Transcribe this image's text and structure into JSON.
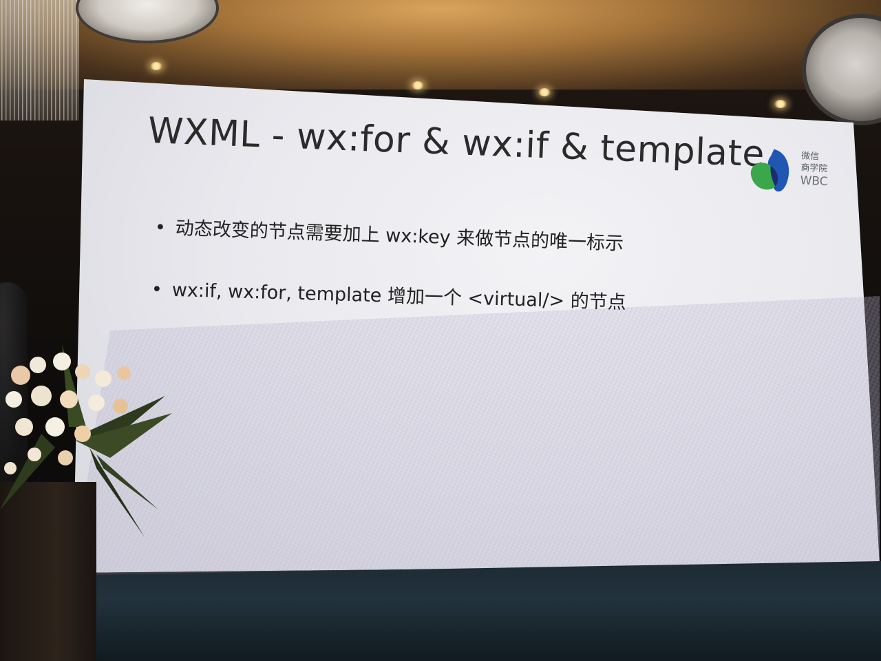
{
  "slide": {
    "title": "WXML - wx:for & wx:if & template",
    "bullets": [
      "动态改变的节点需要加上 wx:key 来做节点的唯一标示",
      "wx:if, wx:for, template 增加一个 <virtual/> 的节点"
    ],
    "bullet_symbol": "•",
    "logo": {
      "line1": "微信",
      "line2": "商学院",
      "line3": "WBC",
      "colors": {
        "blue": "#1f57b3",
        "green": "#3aa84a",
        "navy": "#1c2d6e"
      }
    }
  },
  "colors": {
    "slide_background": "#ececf0",
    "slide_text": "#2b2b2b"
  }
}
